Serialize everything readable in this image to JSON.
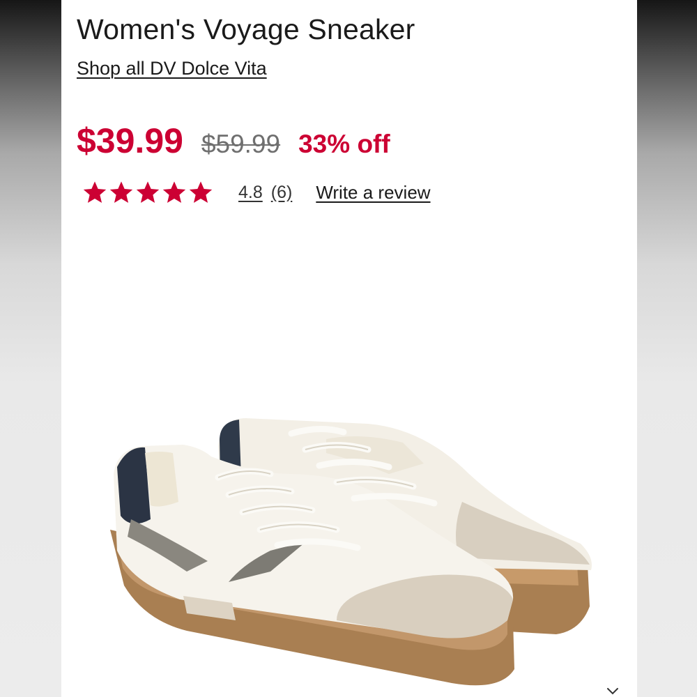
{
  "product": {
    "title": "Women's Voyage Sneaker",
    "brand_link": "Shop all DV Dolce Vita"
  },
  "pricing": {
    "current_price": "$39.99",
    "original_price": "$59.99",
    "discount": "33% off",
    "accent_color": "#cc0033"
  },
  "reviews": {
    "stars_shown": 5,
    "rating": "4.8",
    "count": "(6)",
    "write_review_label": "Write a review"
  },
  "image": {
    "alt": "product-image"
  },
  "icons": {
    "star": "star-icon",
    "chevron": "chevron-down-icon"
  }
}
